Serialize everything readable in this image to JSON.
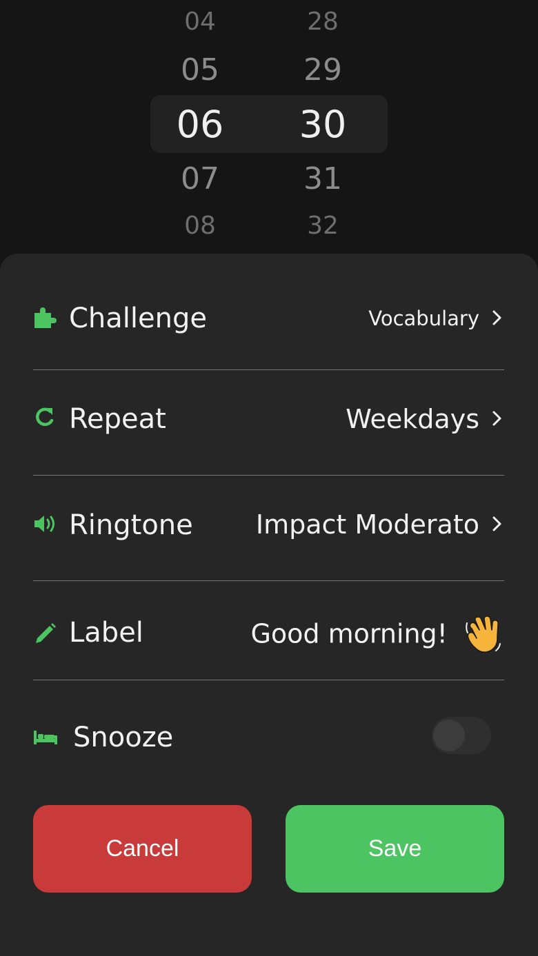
{
  "picker": {
    "hours": [
      "04",
      "05",
      "06",
      "07",
      "08"
    ],
    "minutes": [
      "28",
      "29",
      "30",
      "31",
      "32"
    ],
    "selected_hour": "06",
    "selected_minute": "30"
  },
  "settings": {
    "challenge": {
      "label": "Challenge",
      "value": "Vocabulary",
      "icon": "puzzle-icon"
    },
    "repeat": {
      "label": "Repeat",
      "value": "Weekdays",
      "icon": "repeat-icon"
    },
    "ringtone": {
      "label": "Ringtone",
      "value": "Impact Moderato",
      "icon": "speaker-icon"
    },
    "label": {
      "label": "Label",
      "value": "Good morning!",
      "icon": "pencil-icon",
      "emoji": "waving-hand-icon"
    },
    "snooze": {
      "label": "Snooze",
      "enabled": false,
      "icon": "bed-icon"
    }
  },
  "actions": {
    "cancel_label": "Cancel",
    "save_label": "Save"
  },
  "colors": {
    "accent": "#4cc461",
    "danger": "#c93a3a",
    "sheet": "#262626",
    "background": "#151515"
  }
}
